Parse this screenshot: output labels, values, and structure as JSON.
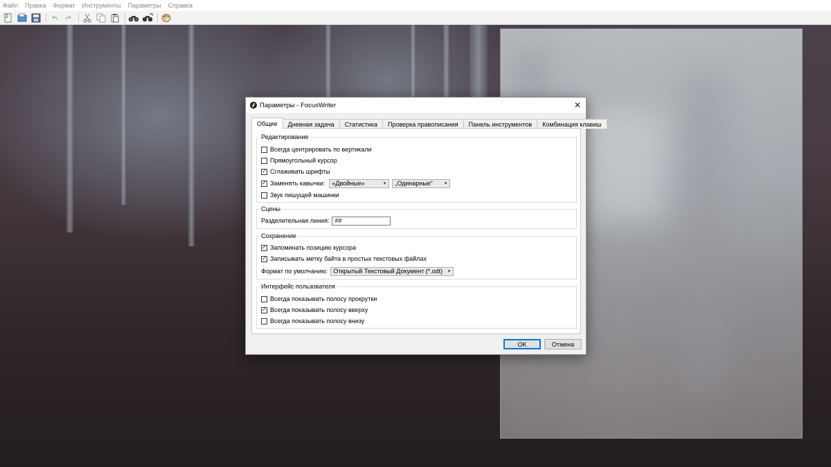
{
  "menubar": {
    "items": [
      "Файл",
      "Правка",
      "Формат",
      "Инструменты",
      "Параметры",
      "Справка"
    ]
  },
  "toolbar": {
    "icons": [
      "new-document-icon",
      "open-icon",
      "save-icon",
      "undo-icon",
      "redo-icon",
      "cut-icon",
      "copy-icon",
      "paste-icon",
      "find-icon",
      "replace-icon",
      "theme-icon"
    ]
  },
  "dialog": {
    "title": "Параметры - FocusWriter",
    "close_glyph": "✕",
    "tabs": [
      {
        "label": "Общие",
        "active": true
      },
      {
        "label": "Дневная задача",
        "active": false
      },
      {
        "label": "Статистика",
        "active": false
      },
      {
        "label": "Проверка правописания",
        "active": false
      },
      {
        "label": "Панель инструментов",
        "active": false
      },
      {
        "label": "Комбинация клавиш",
        "active": false
      }
    ],
    "editing": {
      "title": "Редактирование",
      "center_vertically": {
        "label": "Всегда центрировать по вертикали",
        "checked": false
      },
      "block_cursor": {
        "label": "Прямоугольный курсор",
        "checked": false
      },
      "smooth_fonts": {
        "label": "Сглаживать шрифты",
        "checked": true
      },
      "smart_quotes": {
        "label": "Заменять кавычки:",
        "checked": true
      },
      "double_quotes": "«Двойные»",
      "single_quotes": "„Одинарные“",
      "typewriter_sounds": {
        "label": "Звук пишущей машинки",
        "checked": false
      }
    },
    "scenes": {
      "title": "Сцены",
      "divider_label": "Разделительная линия:",
      "divider_value": "##"
    },
    "saving": {
      "title": "Сохранение",
      "remember_cursor": {
        "label": "Запоминать позицию курсора",
        "checked": true
      },
      "write_bom": {
        "label": "Записывать метку байта в простых текстовых файлах",
        "checked": true
      },
      "default_format_label": "Формат по умолчанию:",
      "default_format_value": "Открытый Текстовый Документ (*.odt)"
    },
    "interface": {
      "title": "Интерфейс пользователя",
      "show_scrollbar": {
        "label": "Всегда показывать полосу прокрутки",
        "checked": false
      },
      "show_top_bar": {
        "label": "Всегда показывать полосу вверху",
        "checked": true
      },
      "show_bottom_bar": {
        "label": "Всегда показывать полосу внизу",
        "checked": false
      }
    },
    "ok_label": "OK",
    "cancel_label": "Отмена"
  }
}
